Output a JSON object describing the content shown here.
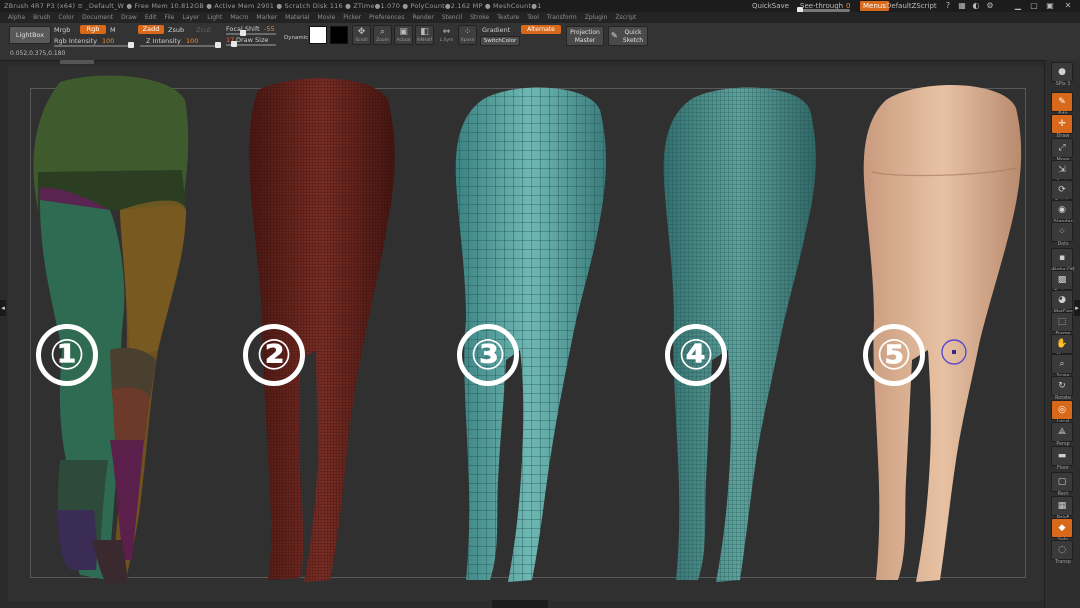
{
  "app": {
    "title": "ZBrush 4R7 P3 (x64)   ≡ _Default_W   ● Free Mem 10.812GB ● Active Mem 2901 ● Scratch Disk 116 ● ZTime●1.070 ● PolyCount●2.162 MP ● MeshCount●1"
  },
  "topright": {
    "quicksave": "QuickSave",
    "see_through_label": "See-through",
    "see_through_value": "0",
    "menus": "Menus",
    "script": "DefaultZScript"
  },
  "menubar": {
    "items": [
      "Alpha",
      "Brush",
      "Color",
      "Document",
      "Draw",
      "Edit",
      "File",
      "Layer",
      "Light",
      "Macro",
      "Marker",
      "Material",
      "Movie",
      "Picker",
      "Preferences",
      "Render",
      "Stencil",
      "Stroke",
      "Texture",
      "Tool",
      "Transform",
      "Zplugin",
      "Zscript"
    ]
  },
  "shelf": {
    "lightbox": "LightBox",
    "coords": "0.052,0.375,0.180",
    "mrgb": "Mrgb",
    "rgb": "Rgb",
    "m": "M",
    "rgb_intensity_label": "Rgb Intensity",
    "rgb_intensity_value": "100",
    "zadd": "Zadd",
    "zsub": "Zsub",
    "zcut": "Zcut",
    "z_intensity_label": "Z Intensity",
    "z_intensity_value": "100",
    "focal_shift_label": "Focal Shift",
    "focal_shift_value": "-55",
    "draw_size_value": "17",
    "draw_size_label": "Draw Size",
    "dynamic": "Dynamic",
    "scroll": "Scroll",
    "zoom": "Zoom",
    "actual": "Actual",
    "aahalf": "AAHalf",
    "lsym": "L.Sym",
    "xyz": "Xpose",
    "gradient": "Gradient",
    "switchcolor": "SwitchColor",
    "alternate": "Alternate",
    "projection_master": "Projection Master",
    "quick_sketch": "Quick Sketch",
    "colors": {
      "main": "#ffffff",
      "secondary": "#000000",
      "accent": "#d9691a"
    }
  },
  "canvas": {
    "labels": [
      "①",
      "②",
      "③",
      "④",
      "⑤"
    ]
  },
  "tray": {
    "items": [
      {
        "cap": "SPix 3",
        "icon": "sphere-icon"
      },
      {
        "cap": "Edit",
        "icon": "edit-icon"
      },
      {
        "cap": "Draw",
        "icon": "draw-icon"
      },
      {
        "cap": "Move",
        "icon": "move-icon"
      },
      {
        "cap": "Scale",
        "icon": "scale-icon"
      },
      {
        "cap": "Rotate",
        "icon": "rotate-icon"
      },
      {
        "cap": "Standar",
        "icon": "standard-brush-icon"
      },
      {
        "cap": "Dots",
        "icon": "dots-icon"
      },
      {
        "cap": "Alpha Off",
        "icon": "alpha-icon"
      },
      {
        "cap": "Texture",
        "icon": "texture-icon"
      },
      {
        "cap": "MatCap",
        "icon": "matcap-icon"
      },
      {
        "cap": "Frame",
        "icon": "frame-icon"
      },
      {
        "cap": "Move",
        "icon": "pan-icon"
      },
      {
        "cap": "Scale",
        "icon": "zoom-icon"
      },
      {
        "cap": "Rotate",
        "icon": "orbit-icon"
      },
      {
        "cap": "Local",
        "icon": "local-icon"
      },
      {
        "cap": "Persp",
        "icon": "perspective-icon"
      },
      {
        "cap": "Floor",
        "icon": "floor-icon"
      },
      {
        "cap": "Rect",
        "icon": "rect-icon"
      },
      {
        "cap": "PolyF",
        "icon": "polyframe-icon"
      },
      {
        "cap": "Solo",
        "icon": "solo-icon"
      },
      {
        "cap": "Transp",
        "icon": "transparency-icon"
      }
    ]
  }
}
